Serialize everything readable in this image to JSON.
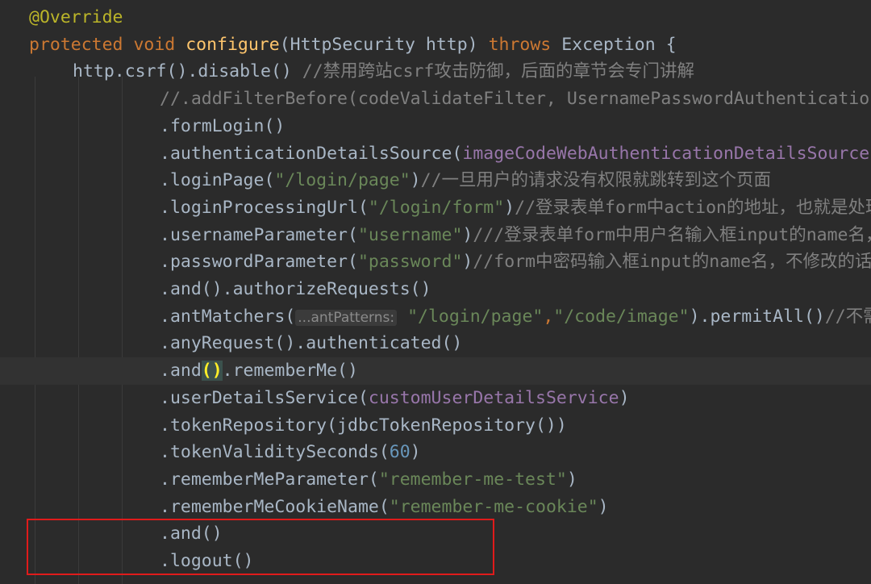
{
  "colors": {
    "background": "#2b2b2b",
    "current_line": "#323232",
    "default": "#a9b7c6",
    "keyword": "#cc7832",
    "method_decl": "#ffc66d",
    "string": "#6a8759",
    "comment": "#808080",
    "field": "#9876aa",
    "annotation": "#bbb529",
    "number": "#6897bb",
    "inlay_hint": "#8a8a8a",
    "highlight_box": "#e01b1b"
  },
  "lines": [
    {
      "indent": 36,
      "tokens": [
        {
          "t": "@Override",
          "c": "annotation"
        }
      ]
    },
    {
      "indent": 36,
      "tokens": [
        {
          "t": "protected",
          "c": "keyword"
        },
        {
          "t": " ",
          "c": "default"
        },
        {
          "t": "void",
          "c": "keyword"
        },
        {
          "t": " ",
          "c": "default"
        },
        {
          "t": "configure",
          "c": "method_decl"
        },
        {
          "t": "(HttpSecurity http) ",
          "c": "default"
        },
        {
          "t": "throws",
          "c": "keyword"
        },
        {
          "t": " Exception {",
          "c": "default"
        }
      ]
    },
    {
      "indent": 90,
      "tokens": [
        {
          "t": "http.csrf().disable() ",
          "c": "default"
        },
        {
          "t": "//禁用跨站csrf攻击防御，后面的章节会专门讲解",
          "c": "comment"
        }
      ]
    },
    {
      "indent": 198,
      "tokens": [
        {
          "t": "//.addFilterBefore(codeValidateFilter, UsernamePasswordAuthenticationFilter.class)",
          "c": "comment"
        }
      ]
    },
    {
      "indent": 198,
      "tokens": [
        {
          "t": ".formLogin()",
          "c": "default"
        }
      ]
    },
    {
      "indent": 198,
      "tokens": [
        {
          "t": ".authenticationDetailsSource(",
          "c": "default"
        },
        {
          "t": "imageCodeWebAuthenticationDetailsSource",
          "c": "field"
        },
        {
          "t": ")",
          "c": "default"
        }
      ]
    },
    {
      "indent": 198,
      "tokens": [
        {
          "t": ".loginPage(",
          "c": "default"
        },
        {
          "t": "\"/login/page\"",
          "c": "string"
        },
        {
          "t": ")",
          "c": "default"
        },
        {
          "t": "//一旦用户的请求没有权限就跳转到这个页面",
          "c": "comment"
        }
      ]
    },
    {
      "indent": 198,
      "tokens": [
        {
          "t": ".loginProcessingUrl(",
          "c": "default"
        },
        {
          "t": "\"/login/form\"",
          "c": "string"
        },
        {
          "t": ")",
          "c": "default"
        },
        {
          "t": "//登录表单form中action的地址，也就是处理认证请求的路径",
          "c": "comment"
        }
      ]
    },
    {
      "indent": 198,
      "tokens": [
        {
          "t": ".usernameParameter(",
          "c": "default"
        },
        {
          "t": "\"username\"",
          "c": "string"
        },
        {
          "t": ")",
          "c": "default"
        },
        {
          "t": "///登录表单form中用户名输入框input的name名，不修改的话默认是username",
          "c": "comment"
        }
      ]
    },
    {
      "indent": 198,
      "tokens": [
        {
          "t": ".passwordParameter(",
          "c": "default"
        },
        {
          "t": "\"password\"",
          "c": "string"
        },
        {
          "t": ")",
          "c": "default"
        },
        {
          "t": "//form中密码输入框input的name名，不修改的话默认是password",
          "c": "comment"
        }
      ]
    },
    {
      "indent": 198,
      "tokens": [
        {
          "t": ".and().authorizeRequests()",
          "c": "default"
        }
      ]
    },
    {
      "indent": 198,
      "tokens": [
        {
          "t": ".antMatchers(",
          "c": "default"
        },
        {
          "t": "...antPatterns:",
          "c": "hint"
        },
        {
          "t": " ",
          "c": "default"
        },
        {
          "t": "\"/login/page\"",
          "c": "string"
        },
        {
          "t": ",",
          "c": "keyword"
        },
        {
          "t": "\"/code/image\"",
          "c": "string"
        },
        {
          "t": ").permitAll()",
          "c": "default"
        },
        {
          "t": "//不需要通过登录验证就可以被访问的资源路径",
          "c": "comment"
        }
      ]
    },
    {
      "indent": 198,
      "tokens": [
        {
          "t": ".anyRequest().authenticated()",
          "c": "default"
        }
      ]
    },
    {
      "indent": 198,
      "current": true,
      "tokens": [
        {
          "t": ".and",
          "c": "default"
        },
        {
          "t": "()",
          "c": "brace"
        },
        {
          "t": ".rememberMe()",
          "c": "default"
        }
      ]
    },
    {
      "indent": 198,
      "tokens": [
        {
          "t": ".userDetailsService(",
          "c": "default"
        },
        {
          "t": "customUserDetailsService",
          "c": "field"
        },
        {
          "t": ")",
          "c": "default"
        }
      ]
    },
    {
      "indent": 198,
      "tokens": [
        {
          "t": ".tokenRepository(jdbcTokenRepository())",
          "c": "default"
        }
      ]
    },
    {
      "indent": 198,
      "tokens": [
        {
          "t": ".tokenValiditySeconds(",
          "c": "default"
        },
        {
          "t": "60",
          "c": "number"
        },
        {
          "t": ")",
          "c": "default"
        }
      ]
    },
    {
      "indent": 198,
      "tokens": [
        {
          "t": ".rememberMeParameter(",
          "c": "default"
        },
        {
          "t": "\"remember-me-test\"",
          "c": "string"
        },
        {
          "t": ")",
          "c": "default"
        }
      ]
    },
    {
      "indent": 198,
      "tokens": [
        {
          "t": ".rememberMeCookieName(",
          "c": "default"
        },
        {
          "t": "\"remember-me-cookie\"",
          "c": "string"
        },
        {
          "t": ")",
          "c": "default"
        }
      ]
    },
    {
      "indent": 198,
      "tokens": [
        {
          "t": ".and()",
          "c": "default"
        }
      ]
    },
    {
      "indent": 198,
      "tokens": [
        {
          "t": ".logout()",
          "c": "default"
        }
      ]
    }
  ]
}
